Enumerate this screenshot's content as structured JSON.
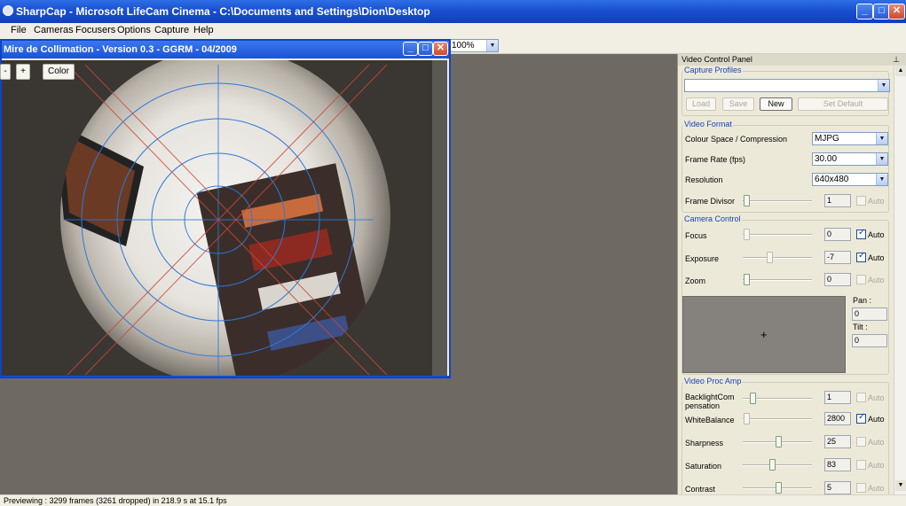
{
  "app": {
    "title": "SharpCap - Microsoft LifeCam Cinema - C:\\Documents and Settings\\Dion\\Desktop",
    "window_buttons": {
      "minimize": "_",
      "maximize": "□",
      "close": "✕"
    }
  },
  "menu": [
    "File",
    "Cameras",
    "Focusers",
    "Options",
    "Capture",
    "Help"
  ],
  "toolbar": {
    "zoom_value": "100%"
  },
  "collimation": {
    "title": "Mire de Collimation - Version 0.3 - GGRM - 04/2009",
    "buttons": {
      "minus": "-",
      "plus": "+",
      "color": "Color"
    }
  },
  "panel": {
    "title": "Video Control Panel",
    "pin": "⊥",
    "capture_profiles": {
      "title": "Capture Profiles",
      "profile_value": "",
      "buttons": {
        "load": "Load",
        "save": "Save",
        "new": "New",
        "set_default": "Set Default"
      }
    },
    "video_format": {
      "title": "Video Format",
      "colour_space_label": "Colour Space / Compression",
      "colour_space_value": "MJPG",
      "frame_rate_label": "Frame Rate (fps)",
      "frame_rate_value": "30.00",
      "resolution_label": "Resolution",
      "resolution_value": "640x480",
      "frame_divisor_label": "Frame Divisor",
      "frame_divisor_value": "1",
      "frame_divisor_auto": "Auto"
    },
    "camera_control": {
      "title": "Camera Control",
      "focus_label": "Focus",
      "focus_value": "0",
      "focus_auto": "Auto",
      "exposure_label": "Exposure",
      "exposure_value": "-7",
      "exposure_auto": "Auto",
      "zoom_label": "Zoom",
      "zoom_value": "0",
      "zoom_auto": "Auto",
      "pan_label": "Pan :",
      "pan_value": "0",
      "tilt_label": "Tilt :",
      "tilt_value": "0",
      "crosshair": "+"
    },
    "proc_amp": {
      "title": "Video Proc Amp",
      "backlight_label_1": "BacklightCom",
      "backlight_label_2": "pensation",
      "backlight_value": "1",
      "backlight_auto": "Auto",
      "whitebalance_label": "WhiteBalance",
      "whitebalance_value": "2800",
      "whitebalance_auto": "Auto",
      "sharpness_label": "Sharpness",
      "sharpness_value": "25",
      "sharpness_auto": "Auto",
      "saturation_label": "Saturation",
      "saturation_value": "83",
      "saturation_auto": "Auto",
      "contrast_label": "Contrast",
      "contrast_value": "5",
      "contrast_auto": "Auto"
    }
  },
  "status": {
    "text": "Previewing : 3299 frames (3261 dropped) in 218.9 s at 15.1 fps"
  },
  "colors": {
    "titlebar": "#1a4fd0",
    "crosshair_blue": "#2d78d8",
    "crosshair_red": "#c8493a",
    "accent_label": "#1a44b8"
  }
}
